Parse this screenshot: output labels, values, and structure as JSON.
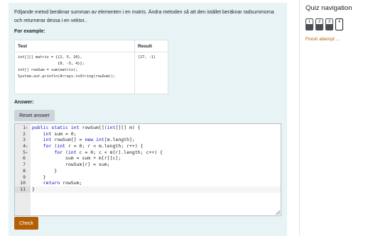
{
  "question": {
    "text": "Följande metod beräknar summan av elementen i en matris. Ändra metoden så att den istället beräknar radsummorna och returnerar dessa i en vektor..",
    "example_label": "For example:",
    "table": {
      "headers": [
        "Test",
        "Result"
      ],
      "test_lines": [
        "int[][] matrix = {{2, 5, 10},",
        "                  {0, -5, 4}};",
        "int[] rowSum = sum(matrix);",
        "System.out.println(Arrays.toString(rowSum));"
      ],
      "result": "[17, -1]"
    }
  },
  "answer": {
    "label": "Answer:",
    "reset_label": "Reset answer",
    "code_lines": [
      {
        "num": "1",
        "fold": "▾",
        "text": "public static int rowSum[](int[][] m) {"
      },
      {
        "num": "2",
        "fold": "",
        "text": "    int sum = 0;"
      },
      {
        "num": "3",
        "fold": "",
        "text": "    int rowSum[] = new int[m.length];"
      },
      {
        "num": "4",
        "fold": "▾",
        "text": "    for (int r = 0; r < m.length; r++) {"
      },
      {
        "num": "5",
        "fold": "▾",
        "text": "        for (int c = 0; c < m[r].length; c++) {"
      },
      {
        "num": "6",
        "fold": "",
        "text": "            sum = sum + m[r][c];"
      },
      {
        "num": "7",
        "fold": "",
        "text": "            rowSum[r] = sum;"
      },
      {
        "num": "8",
        "fold": "",
        "text": "        }"
      },
      {
        "num": "9",
        "fold": "",
        "text": "    }"
      },
      {
        "num": "10",
        "fold": "",
        "text": "    return rowSum;"
      },
      {
        "num": "11",
        "fold": "",
        "text": "}"
      }
    ],
    "active_line": 11,
    "check_label": "Check"
  },
  "sidebar": {
    "title": "Quiz navigation",
    "questions": [
      {
        "label": "1",
        "answered": true,
        "current": false
      },
      {
        "label": "2",
        "answered": true,
        "current": false
      },
      {
        "label": "3",
        "answered": true,
        "current": false
      },
      {
        "label": "4",
        "answered": false,
        "current": true
      }
    ],
    "finish_label": "Finish attempt ..."
  },
  "colors": {
    "accent": "#b45f06",
    "question_bg": "#e7f3f5",
    "keyword": "#0000c8"
  }
}
